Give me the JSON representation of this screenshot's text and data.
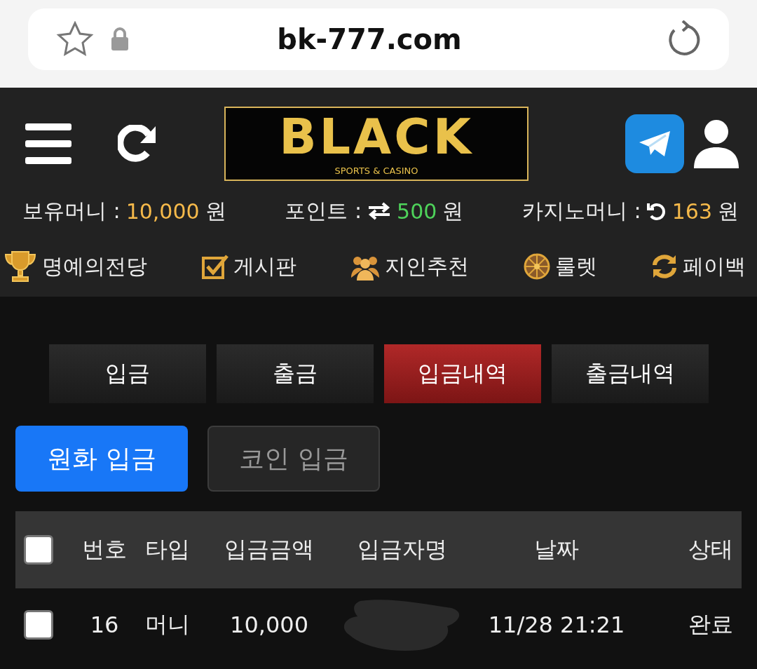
{
  "browser": {
    "url": "bk-777.com"
  },
  "header": {
    "logo": {
      "title": "BLACK",
      "tagline": "SPORTS & CASINO"
    }
  },
  "balances": [
    {
      "label": "보유머니 :",
      "value": "10,000",
      "unit": "원",
      "color": "#f5b94a"
    },
    {
      "label": "포인트 :",
      "value": "500",
      "unit": "원",
      "color": "#4ed25a"
    },
    {
      "label": "카지노머니 :",
      "value": "163",
      "unit": "원",
      "color": "#f5b94a"
    }
  ],
  "menu": [
    {
      "label": "명예의전당"
    },
    {
      "label": "게시판"
    },
    {
      "label": "지인추천"
    },
    {
      "label": "룰렛"
    },
    {
      "label": "페이백"
    }
  ],
  "tabs": [
    {
      "label": "입금",
      "selected": false
    },
    {
      "label": "출금",
      "selected": false
    },
    {
      "label": "입금내역",
      "selected": true
    },
    {
      "label": "출금내역",
      "selected": false
    }
  ],
  "subtabs": [
    {
      "label": "원화 입금",
      "selected": true
    },
    {
      "label": "코인 입금",
      "selected": false
    }
  ],
  "table": {
    "all_checked": false,
    "columns": [
      "번호",
      "타입",
      "입금금액",
      "입금자명",
      "날짜",
      "상태"
    ],
    "rows": [
      {
        "checked": false,
        "cells": [
          "16",
          "머니",
          "10,000",
          null,
          "11/28 21:21",
          "완료"
        ]
      }
    ]
  }
}
